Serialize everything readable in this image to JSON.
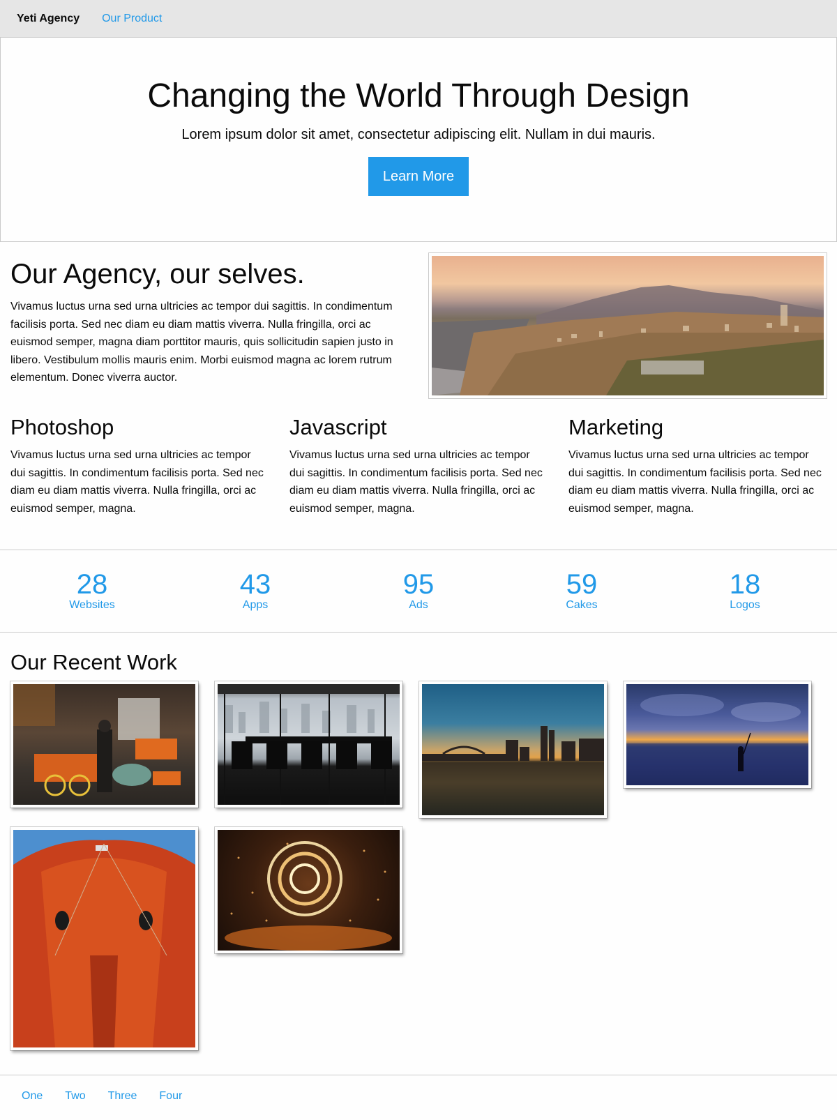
{
  "topbar": {
    "brand": "Yeti Agency",
    "nav_link": "Our Product"
  },
  "hero": {
    "title": "Changing the World Through Design",
    "subtitle": "Lorem ipsum dolor sit amet, consectetur adipiscing elit. Nullam in dui mauris.",
    "button_label": "Learn More"
  },
  "agency": {
    "heading": "Our Agency, our selves.",
    "body": "Vivamus luctus urna sed urna ultricies ac tempor dui sagittis. In condimentum facilisis porta. Sed nec diam eu diam mattis viverra. Nulla fringilla, orci ac euismod semper, magna diam porttitor mauris, quis sollicitudin sapien justo in libero. Vestibulum mollis mauris enim. Morbi euismod magna ac lorem rutrum elementum. Donec viverra auctor."
  },
  "columns": [
    {
      "heading": "Photoshop",
      "body": "Vivamus luctus urna sed urna ultricies ac tempor dui sagittis. In condimentum facilisis porta. Sed nec diam eu diam mattis viverra. Nulla fringilla, orci ac euismod semper, magna."
    },
    {
      "heading": "Javascript",
      "body": "Vivamus luctus urna sed urna ultricies ac tempor dui sagittis. In condimentum facilisis porta. Sed nec diam eu diam mattis viverra. Nulla fringilla, orci ac euismod semper, magna."
    },
    {
      "heading": "Marketing",
      "body": "Vivamus luctus urna sed urna ultricies ac tempor dui sagittis. In condimentum facilisis porta. Sed nec diam eu diam mattis viverra. Nulla fringilla, orci ac euismod semper, magna."
    }
  ],
  "stats": [
    {
      "number": "28",
      "label": "Websites"
    },
    {
      "number": "43",
      "label": "Apps"
    },
    {
      "number": "95",
      "label": "Ads"
    },
    {
      "number": "59",
      "label": "Cakes"
    },
    {
      "number": "18",
      "label": "Logos"
    }
  ],
  "recent": {
    "heading": "Our Recent Work"
  },
  "footer": {
    "links": [
      "One",
      "Two",
      "Three",
      "Four"
    ]
  },
  "colors": {
    "accent": "#2199e8",
    "topbar_bg": "#e6e6e6",
    "text": "#0a0a0a",
    "border": "#cacaca"
  }
}
